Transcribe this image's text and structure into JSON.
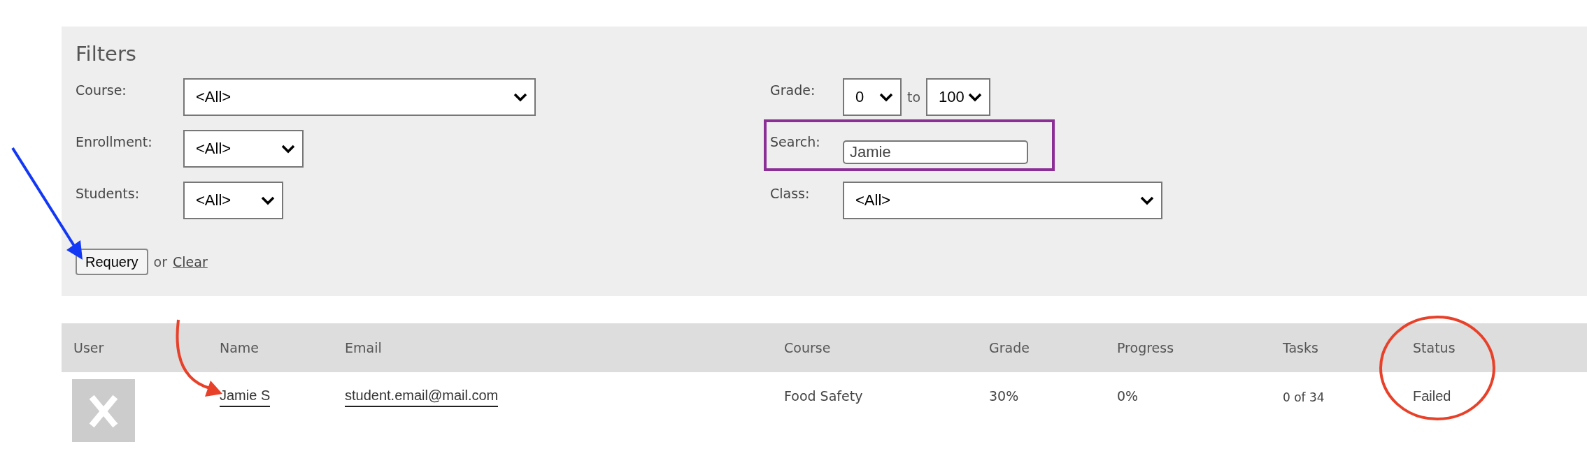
{
  "filters": {
    "title": "Filters",
    "left": [
      {
        "label": "Course:",
        "value": "<All>"
      },
      {
        "label": "Enrollment:",
        "value": "<All>"
      },
      {
        "label": "Students:",
        "value": "<All>"
      }
    ],
    "grade": {
      "label": "Grade:",
      "from": "0",
      "separator": "to",
      "to": "100"
    },
    "search": {
      "label": "Search:",
      "value": "Jamie",
      "highlighted": true
    },
    "class": {
      "label": "Class:",
      "value": "<All>"
    },
    "actions": {
      "button": "Requery",
      "separator": "or",
      "link": "Clear"
    }
  },
  "table": {
    "columns": [
      "User",
      "Name",
      "Email",
      "Course",
      "Grade",
      "Progress",
      "Tasks",
      "Status"
    ],
    "rows": [
      {
        "name": "Jamie S",
        "email": "student.email@mail.com",
        "course": "Food Safety",
        "grade": "30%",
        "progress": "0%",
        "tasks": "0 of 34",
        "status": "Failed"
      }
    ]
  },
  "annotations": [
    {
      "kind": "arrow",
      "color": "#1238f5"
    },
    {
      "kind": "curved-arrow",
      "color": "#e8412a"
    },
    {
      "kind": "circle",
      "color": "#e8412a"
    }
  ]
}
